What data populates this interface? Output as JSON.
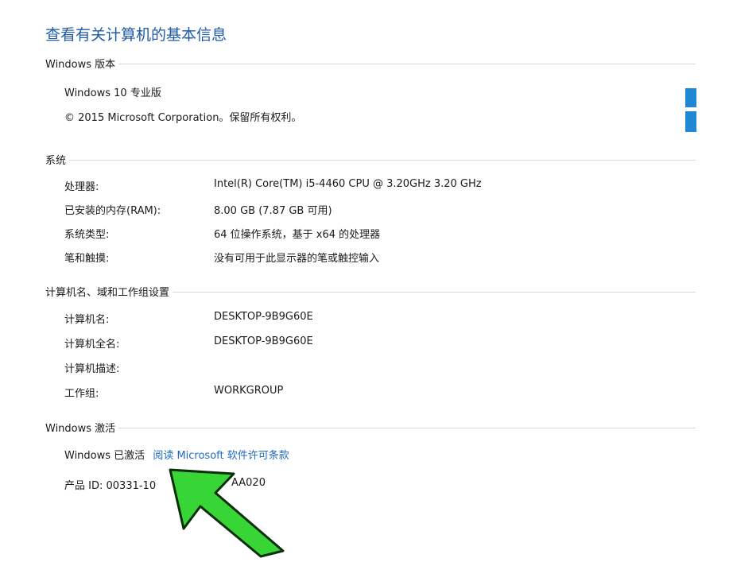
{
  "page_title": "查看有关计算机的基本信息",
  "windows_edition": {
    "heading": "Windows 版本",
    "name": "Windows 10 专业版",
    "copyright": "© 2015 Microsoft Corporation。保留所有权利。"
  },
  "system": {
    "heading": "系统",
    "rows": [
      {
        "label": "处理器:",
        "value": "Intel(R) Core(TM) i5-4460  CPU @ 3.20GHz   3.20 GHz"
      },
      {
        "label": "已安装的内存(RAM):",
        "value": "8.00 GB (7.87 GB 可用)"
      },
      {
        "label": "系统类型:",
        "value": "64 位操作系统，基于 x64 的处理器"
      },
      {
        "label": "笔和触摸:",
        "value": "没有可用于此显示器的笔或触控输入"
      }
    ]
  },
  "computer_name": {
    "heading": "计算机名、域和工作组设置",
    "rows": [
      {
        "label": "计算机名:",
        "value": "DESKTOP-9B9G60E"
      },
      {
        "label": "计算机全名:",
        "value": "DESKTOP-9B9G60E"
      },
      {
        "label": "计算机描述:",
        "value": ""
      },
      {
        "label": "工作组:",
        "value": "WORKGROUP"
      }
    ]
  },
  "activation": {
    "heading": "Windows 激活",
    "status": "Windows 已激活",
    "license_link": "阅读 Microsoft 软件许可条款",
    "product_id_label": "产品 ID:",
    "product_id_visible_start": "00331-10",
    "product_id_visible_end": "AA020"
  },
  "colors": {
    "title": "#1e5aa8",
    "link": "#1e6bc4",
    "logo": "#1f88d6",
    "arrow_fill": "#37d536",
    "arrow_stroke": "#0b2e0b"
  }
}
